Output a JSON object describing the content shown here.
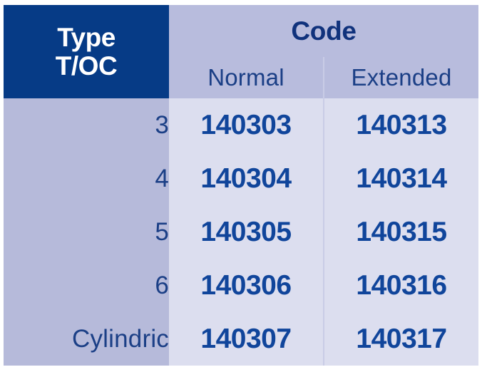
{
  "table": {
    "header": {
      "type_label_line1": "Type",
      "type_label_line2": "T/OC",
      "code_label": "Code",
      "sub_normal": "Normal",
      "sub_extended": "Extended"
    },
    "rows": [
      {
        "type": "3",
        "normal": "140303",
        "extended": "140313"
      },
      {
        "type": "4",
        "normal": "140304",
        "extended": "140314"
      },
      {
        "type": "5",
        "normal": "140305",
        "extended": "140315"
      },
      {
        "type": "6",
        "normal": "140306",
        "extended": "140316"
      },
      {
        "type": "Cylindric",
        "normal": "140307",
        "extended": "140317"
      }
    ],
    "colors": {
      "header_navy_bg": "#063b86",
      "header_navy_text": "#ffffff",
      "header_code_bg": "#b8bcdd",
      "header_code_text": "#10327c",
      "type_cell_bg": "#b6bada",
      "type_cell_text": "#1b3f86",
      "code_cell_bg": "#dcdeef",
      "code_cell_text": "#10459b",
      "grid_line": "#c9cce6",
      "page_bg": "#ffffff"
    }
  }
}
